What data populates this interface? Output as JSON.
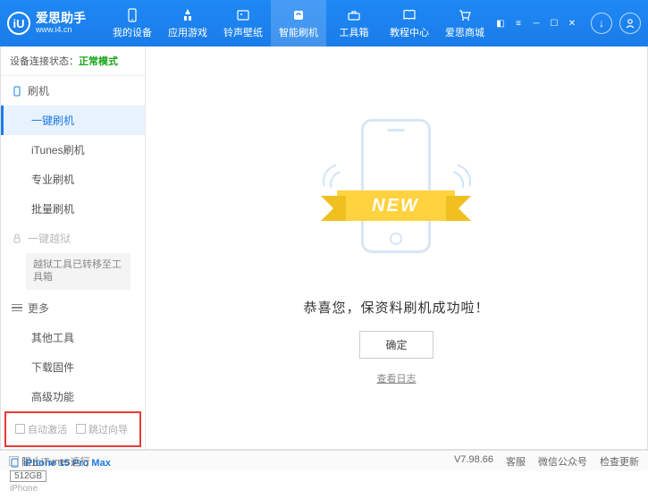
{
  "header": {
    "logo_main": "爱思助手",
    "logo_sub": "www.i4.cn",
    "logo_letter": "iU",
    "nav": [
      {
        "label": "我的设备"
      },
      {
        "label": "应用游戏"
      },
      {
        "label": "铃声壁纸"
      },
      {
        "label": "智能刷机"
      },
      {
        "label": "工具箱"
      },
      {
        "label": "教程中心"
      },
      {
        "label": "爱思商城"
      }
    ]
  },
  "sidebar": {
    "status_label": "设备连接状态：",
    "status_mode": "正常模式",
    "group_flash": "刷机",
    "items_flash": [
      {
        "label": "一键刷机"
      },
      {
        "label": "iTunes刷机"
      },
      {
        "label": "专业刷机"
      },
      {
        "label": "批量刷机"
      }
    ],
    "group_jail": "一键越狱",
    "jail_note": "越狱工具已转移至工具箱",
    "group_more": "更多",
    "items_more": [
      {
        "label": "其他工具"
      },
      {
        "label": "下载固件"
      },
      {
        "label": "高级功能"
      }
    ],
    "cb_auto": "自动激活",
    "cb_skip": "跳过向导",
    "device_name": "iPhone 15 Pro Max",
    "device_storage": "512GB",
    "device_type": "iPhone"
  },
  "main": {
    "new_text": "NEW",
    "success": "恭喜您，保资料刷机成功啦！",
    "ok": "确定",
    "log": "查看日志"
  },
  "footer": {
    "block_itunes": "阻止iTunes运行",
    "version": "V7.98.66",
    "items": [
      "客服",
      "微信公众号",
      "检查更新"
    ]
  }
}
